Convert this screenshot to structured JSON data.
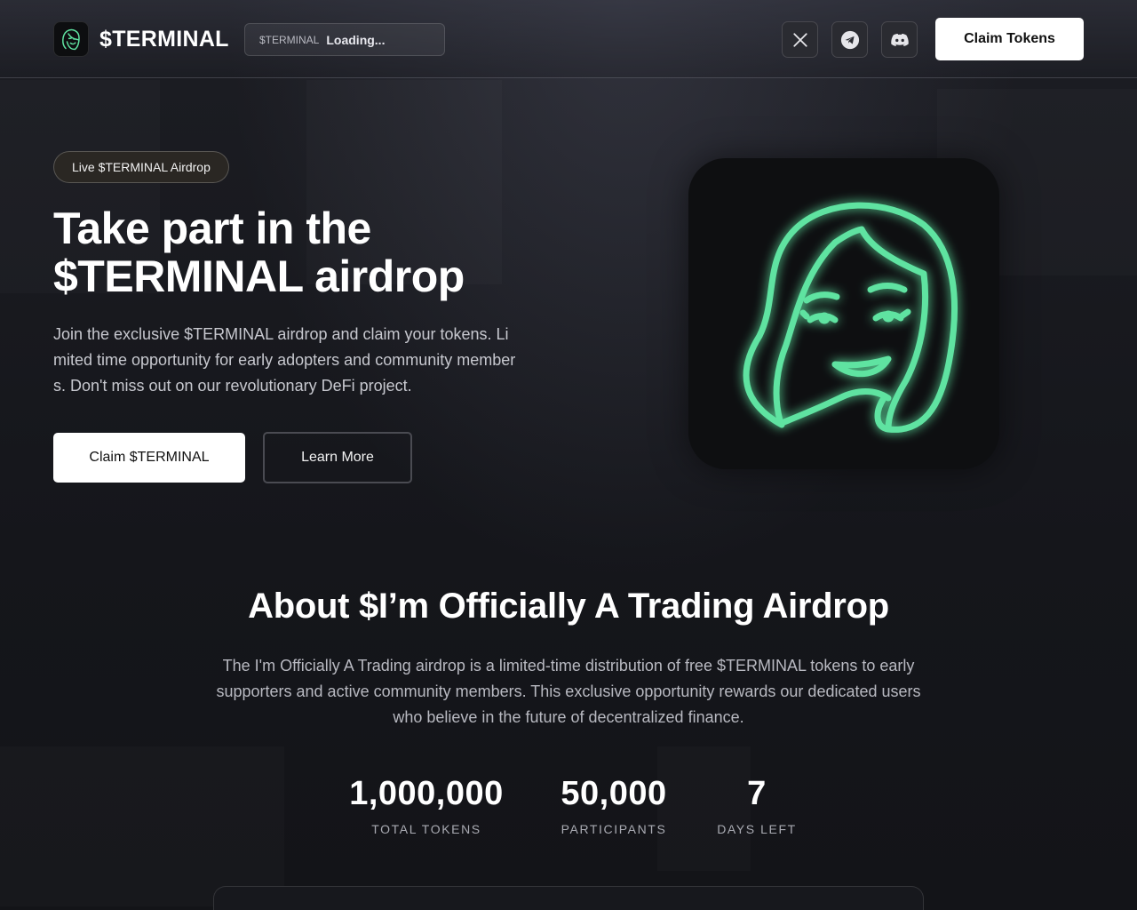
{
  "header": {
    "brand_name": "$TERMINAL",
    "ticker_symbol": "$TERMINAL",
    "ticker_value": "Loading...",
    "social": [
      "x-icon",
      "telegram-icon",
      "discord-icon"
    ],
    "cta_label": "Claim Tokens"
  },
  "hero": {
    "badge": "Live $TERMINAL Airdrop",
    "title_line1": "Take part in the",
    "title_line2": "$TERMINAL airdrop",
    "description": " Join the exclusive $TERMINAL airdrop and claim your tokens. Limited time opportunity for early adopters and community members. Don't miss out on our revolutionary DeFi project.",
    "primary_button": "Claim $TERMINAL",
    "secondary_button": "Learn More",
    "art_icon": "neon-face-icon"
  },
  "about": {
    "title": "About $I’m Officially A Trading Airdrop",
    "description": "The I'm Officially A Trading airdrop is a limited-time distribution of free $TERMINAL tokens to early supporters and active community members. This exclusive opportunity rewards our dedicated users who believe in the future of decentralized finance.",
    "stats": [
      {
        "value": "1,000,000",
        "label": "TOTAL TOKENS"
      },
      {
        "value": "50,000",
        "label": "PARTICIPANTS"
      },
      {
        "value": "7",
        "label": "DAYS LEFT"
      }
    ]
  },
  "colors": {
    "background": "#15161b",
    "accent_green": "#5fe3a1",
    "button_white": "#ffffff"
  }
}
